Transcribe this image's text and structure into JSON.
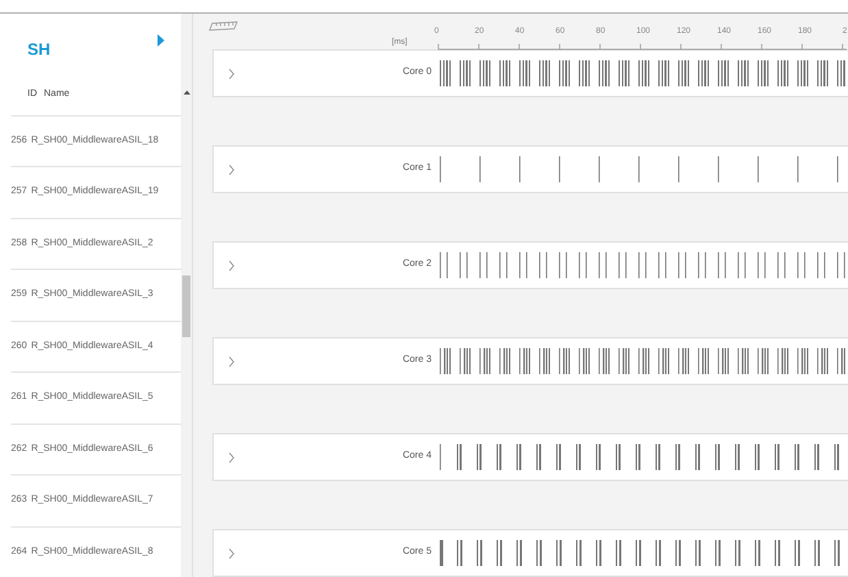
{
  "sidebar": {
    "title": "SH",
    "columns": [
      "ID",
      "Name"
    ],
    "rows": [
      {
        "id": "256",
        "name": "R_SH00_MiddlewareASIL_18"
      },
      {
        "id": "257",
        "name": "R_SH00_MiddlewareASIL_19"
      },
      {
        "id": "258",
        "name": "R_SH00_MiddlewareASIL_2"
      },
      {
        "id": "259",
        "name": "R_SH00_MiddlewareASIL_3"
      },
      {
        "id": "260",
        "name": "R_SH00_MiddlewareASIL_4"
      },
      {
        "id": "261",
        "name": "R_SH00_MiddlewareASIL_5"
      },
      {
        "id": "262",
        "name": "R_SH00_MiddlewareASIL_6"
      },
      {
        "id": "263",
        "name": "R_SH00_MiddlewareASIL_7"
      },
      {
        "id": "264",
        "name": "R_SH00_MiddlewareASIL_8"
      }
    ]
  },
  "axis": {
    "unit": "[ms]",
    "ticks": [
      "0",
      "20",
      "40",
      "60",
      "80",
      "100",
      "120",
      "140",
      "160",
      "180",
      "2"
    ]
  },
  "cores": [
    {
      "label": "Core 0"
    },
    {
      "label": "Core 1"
    },
    {
      "label": "Core 2"
    },
    {
      "label": "Core 3"
    },
    {
      "label": "Core 4"
    },
    {
      "label": "Core 5"
    }
  ]
}
